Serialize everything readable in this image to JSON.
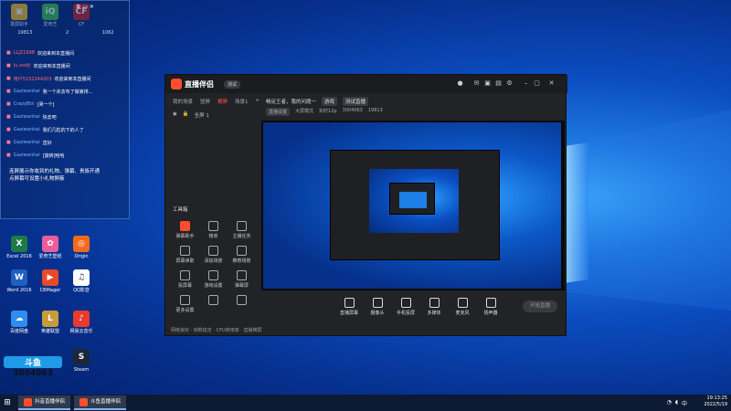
{
  "desktop": {
    "icons": [
      {
        "label": "录屏助手",
        "color": "#f0c020",
        "glyph": "▣"
      },
      {
        "label": "爱奇艺",
        "color": "#37c24a",
        "glyph": "iQ"
      },
      {
        "label": "CF",
        "color": "#c0202a",
        "glyph": "CF"
      },
      {
        "label": "Excel 2016",
        "color": "#1d7a45",
        "glyph": "X"
      },
      {
        "label": "爱奇艺壁纸",
        "color": "#e85d9a",
        "glyph": "✿"
      },
      {
        "label": "Origin",
        "color": "#f06a1e",
        "glyph": "◎"
      },
      {
        "label": "Word 2016",
        "color": "#1f5fbf",
        "glyph": "W"
      },
      {
        "label": "CBMager",
        "color": "#e84a2a",
        "glyph": "▶"
      },
      {
        "label": "QQ影音",
        "color": "#ffffff",
        "glyph": "♫"
      },
      {
        "label": "百度网盘",
        "color": "#2f8cf0",
        "glyph": "☁"
      },
      {
        "label": "英雄联盟",
        "color": "#c89b3c",
        "glyph": "L"
      },
      {
        "label": "网易云音乐",
        "color": "#e83b2e",
        "glyph": "♪"
      },
      {
        "label": "Steam",
        "color": "#1b2838",
        "glyph": "S"
      }
    ]
  },
  "overlay": {
    "tabs": [
      "19813",
      "2",
      "1062"
    ],
    "chat": [
      {
        "name": "LLJZ1998",
        "text": "欢迎来到本直播间"
      },
      {
        "name": "Iu.oodjt",
        "text": "欢迎来到本直播间"
      },
      {
        "name": "用户5152244203",
        "text": "欢迎来到本直播间"
      },
      {
        "name": "Gaziwanhai",
        "text": "我一个杀去布了做第排..."
      },
      {
        "name": "CrazyBtn",
        "text": "[哭一个]"
      },
      {
        "name": "Gaziwanhai",
        "text": "快去吧"
      },
      {
        "name": "Gaziwanhai",
        "text": "我们几粒的下的人了"
      },
      {
        "name": "Gaziwanhai",
        "text": "直好"
      },
      {
        "name": "Gaziwanhai",
        "text": "[旋转]哈哈"
      }
    ],
    "note": "连屏展示你收到的礼物、弹幕、贵族开通\n点屏幕可设置小礼物屏蔽"
  },
  "app": {
    "title": "直播伴侣",
    "version": "测试",
    "left_tabs": [
      "我的场景",
      "竖屏",
      "横屏",
      "场景1"
    ],
    "active_tab": "横屏",
    "scene": "全屏 1",
    "tools_title": "工具箱",
    "tools": [
      "弹幕助手",
      "榜单",
      "主播任务",
      "屏幕读取",
      "添加场景",
      "推荐场景",
      "投屏幕",
      "游戏设置",
      "弹幕屏",
      "更多设置",
      "",
      ""
    ],
    "scene_info": {
      "room": "畅足王者，我的问题一",
      "tag": "游戏",
      "sub": "测试直播",
      "id": "3004063",
      "fans": "19813"
    },
    "sub_info": [
      "直播设置",
      "大屏模式",
      "实时12p"
    ],
    "bottom_bar": [
      "直播屏幕",
      "摄像头",
      "手机投屏",
      "多媒体",
      "麦克风",
      "扬声器"
    ],
    "start_button": "开始直播",
    "status": "网络良好 · 帧数稳定 · CPU使用率 · 直播横屏"
  },
  "watermark": {
    "line1": "斗鱼",
    "line2": "3004063"
  },
  "taskbar": {
    "tasks": [
      "抖音直播伴侣",
      "斗鱼直播伴侣"
    ],
    "time": "19:13:25",
    "date": "2022/5/19"
  }
}
